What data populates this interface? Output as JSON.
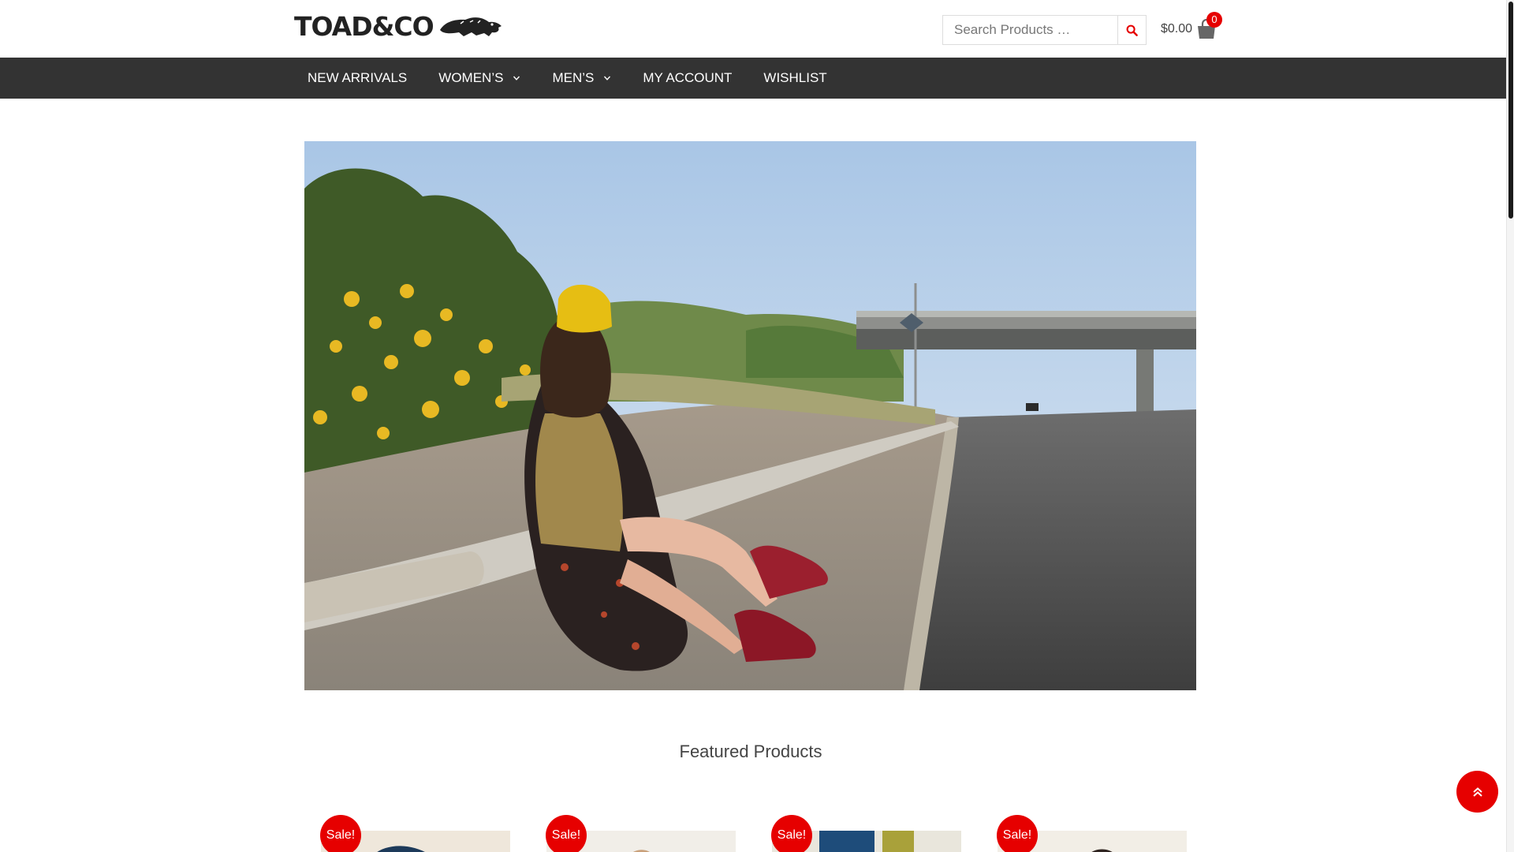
{
  "brand": {
    "logo_text": "TOAD&CO"
  },
  "search": {
    "placeholder": "Search Products …"
  },
  "cart": {
    "total": "$0.00",
    "count": "0"
  },
  "nav": {
    "items": [
      {
        "label": "NEW ARRIVALS",
        "has_dropdown": false
      },
      {
        "label": "WOMEN’S",
        "has_dropdown": true
      },
      {
        "label": "MEN’S",
        "has_dropdown": true
      },
      {
        "label": "MY ACCOUNT",
        "has_dropdown": false
      },
      {
        "label": "WISHLIST",
        "has_dropdown": false
      }
    ]
  },
  "featured": {
    "title": "Featured Products",
    "products": [
      {
        "badge": "Sale!"
      },
      {
        "badge": "Sale!"
      },
      {
        "badge": "Sale!"
      },
      {
        "badge": "Sale!"
      }
    ]
  },
  "colors": {
    "accent": "#e60000",
    "nav_bg": "#333333"
  },
  "icons": {
    "search": "search-icon",
    "cart": "shopping-bag-icon",
    "to_top": "double-chevron-up-icon"
  }
}
